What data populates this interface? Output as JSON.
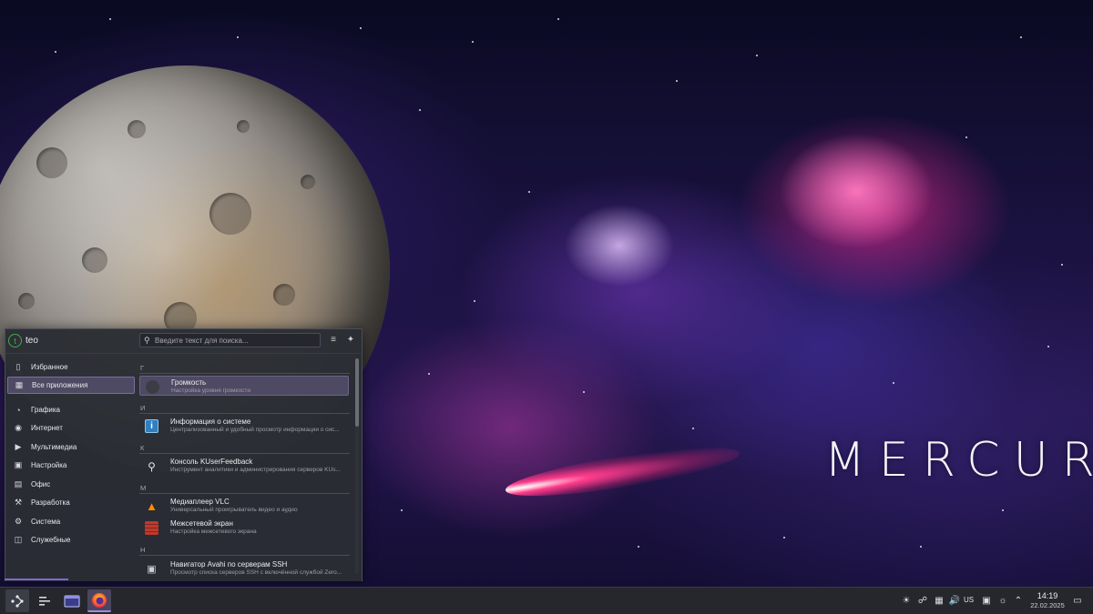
{
  "wallpaper": {
    "title": "MERCURY"
  },
  "launcher": {
    "user": {
      "avatar_initial": "t",
      "name": "teo"
    },
    "search": {
      "placeholder": "Введите текст для поиска..."
    },
    "categories": [
      {
        "label": "Избранное",
        "icon": "bookmark-icon",
        "active": false
      },
      {
        "label": "Все приложения",
        "icon": "grid-icon",
        "active": true
      },
      {
        "label": "Графика",
        "icon": "palette-icon",
        "active": false
      },
      {
        "label": "Интернет",
        "icon": "globe-icon",
        "active": false
      },
      {
        "label": "Мультимедиа",
        "icon": "media-icon",
        "active": false
      },
      {
        "label": "Настройка",
        "icon": "settings-window-icon",
        "active": false
      },
      {
        "label": "Офис",
        "icon": "document-icon",
        "active": false
      },
      {
        "label": "Разработка",
        "icon": "wrench-icon",
        "active": false
      },
      {
        "label": "Система",
        "icon": "gear-icon",
        "active": false
      },
      {
        "label": "Служебные",
        "icon": "toolbox-icon",
        "active": false
      }
    ],
    "sections": [
      {
        "letter": "Г",
        "apps": [
          {
            "name": "Громкость",
            "desc": "Настройка уровня громкости",
            "icon": "volume-app-icon"
          }
        ]
      },
      {
        "letter": "И",
        "apps": [
          {
            "name": "Информация о системе",
            "desc": "Централизованный и удобный просмотр информации о сис...",
            "icon": "info-icon"
          }
        ]
      },
      {
        "letter": "К",
        "apps": [
          {
            "name": "Консоль KUserFeedback",
            "desc": "Инструмент аналитики и администрирования серверов KUs...",
            "icon": "search-tool-icon"
          }
        ]
      },
      {
        "letter": "М",
        "apps": [
          {
            "name": "Медиаплеер VLC",
            "desc": "Универсальный проигрыватель видео и аудио",
            "icon": "vlc-cone-icon"
          },
          {
            "name": "Межсетевой экран",
            "desc": "Настройка межсетевого экрана",
            "icon": "firewall-icon"
          }
        ]
      },
      {
        "letter": "Н",
        "apps": [
          {
            "name": "Навигатор Avahi по серверам SSH",
            "desc": "Просмотр списка серверов SSH с включённой службой Zero...",
            "icon": "monitor-network-icon"
          }
        ]
      }
    ]
  },
  "taskbar": {
    "keyboard_layout": "US",
    "clock": {
      "time": "14:19",
      "date": "22.02.2025"
    }
  },
  "colors": {
    "accent": "#7a6ea0",
    "highlight": "#4f4a63",
    "panel": "#2a2d34",
    "taskbar": "#25272c"
  }
}
